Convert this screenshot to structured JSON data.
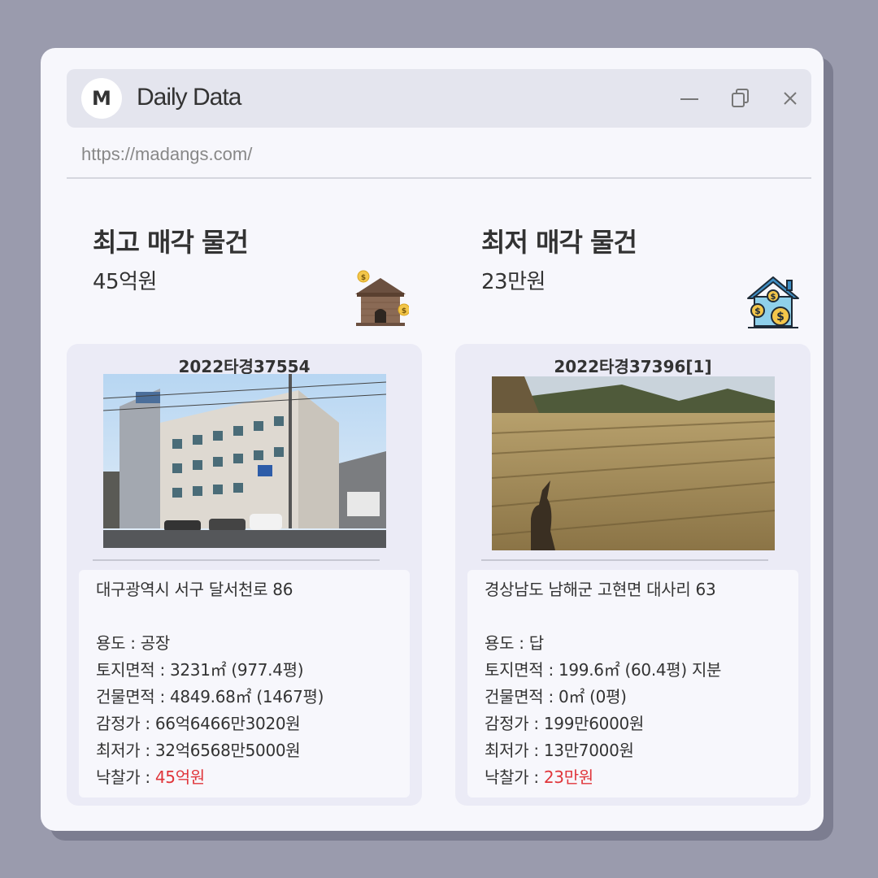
{
  "window": {
    "logo_letter": "M",
    "title": "Daily Data",
    "url": "https://madangs.com/"
  },
  "left": {
    "heading": "최고 매각 물건",
    "price": "45억원",
    "icon": "house-money-brown-icon",
    "case_no": "2022타경37554",
    "photo": "factory-building-photo",
    "address": "대구광역시 서구 달서천로 86",
    "usage_label": "용도 : ",
    "usage": "공장",
    "land_label": "토지면적 : ",
    "land": "3231㎡ (977.4평)",
    "building_label": "건물면적 : ",
    "building": "4849.68㎡ (1467평)",
    "appraisal_label": "감정가 : ",
    "appraisal": "66억6466만3020원",
    "minimum_label": "최저가 : ",
    "minimum": "32억6568만5000원",
    "winning_label": "낙찰가 : ",
    "winning": "45억원"
  },
  "right": {
    "heading": "최저 매각 물건",
    "price": "23만원",
    "icon": "house-money-blue-icon",
    "case_no": "2022타경37396[1]",
    "photo": "dry-field-photo",
    "address": "경상남도 남해군 고현면 대사리 63",
    "usage_label": "용도 : ",
    "usage": "답",
    "land_label": "토지면적 : ",
    "land": "199.6㎡ (60.4평) 지분",
    "building_label": "건물면적 : ",
    "building": "0㎡ (0평)",
    "appraisal_label": "감정가 : ",
    "appraisal": "199만6000원",
    "minimum_label": "최저가 : ",
    "minimum": "13만7000원",
    "winning_label": "낙찰가 : ",
    "winning": "23만원"
  },
  "colors": {
    "background": "#9a9bad",
    "window": "#f7f7fc",
    "titlebar": "#e4e5ee",
    "card": "#ebebf6",
    "highlight": "#e0353a"
  }
}
